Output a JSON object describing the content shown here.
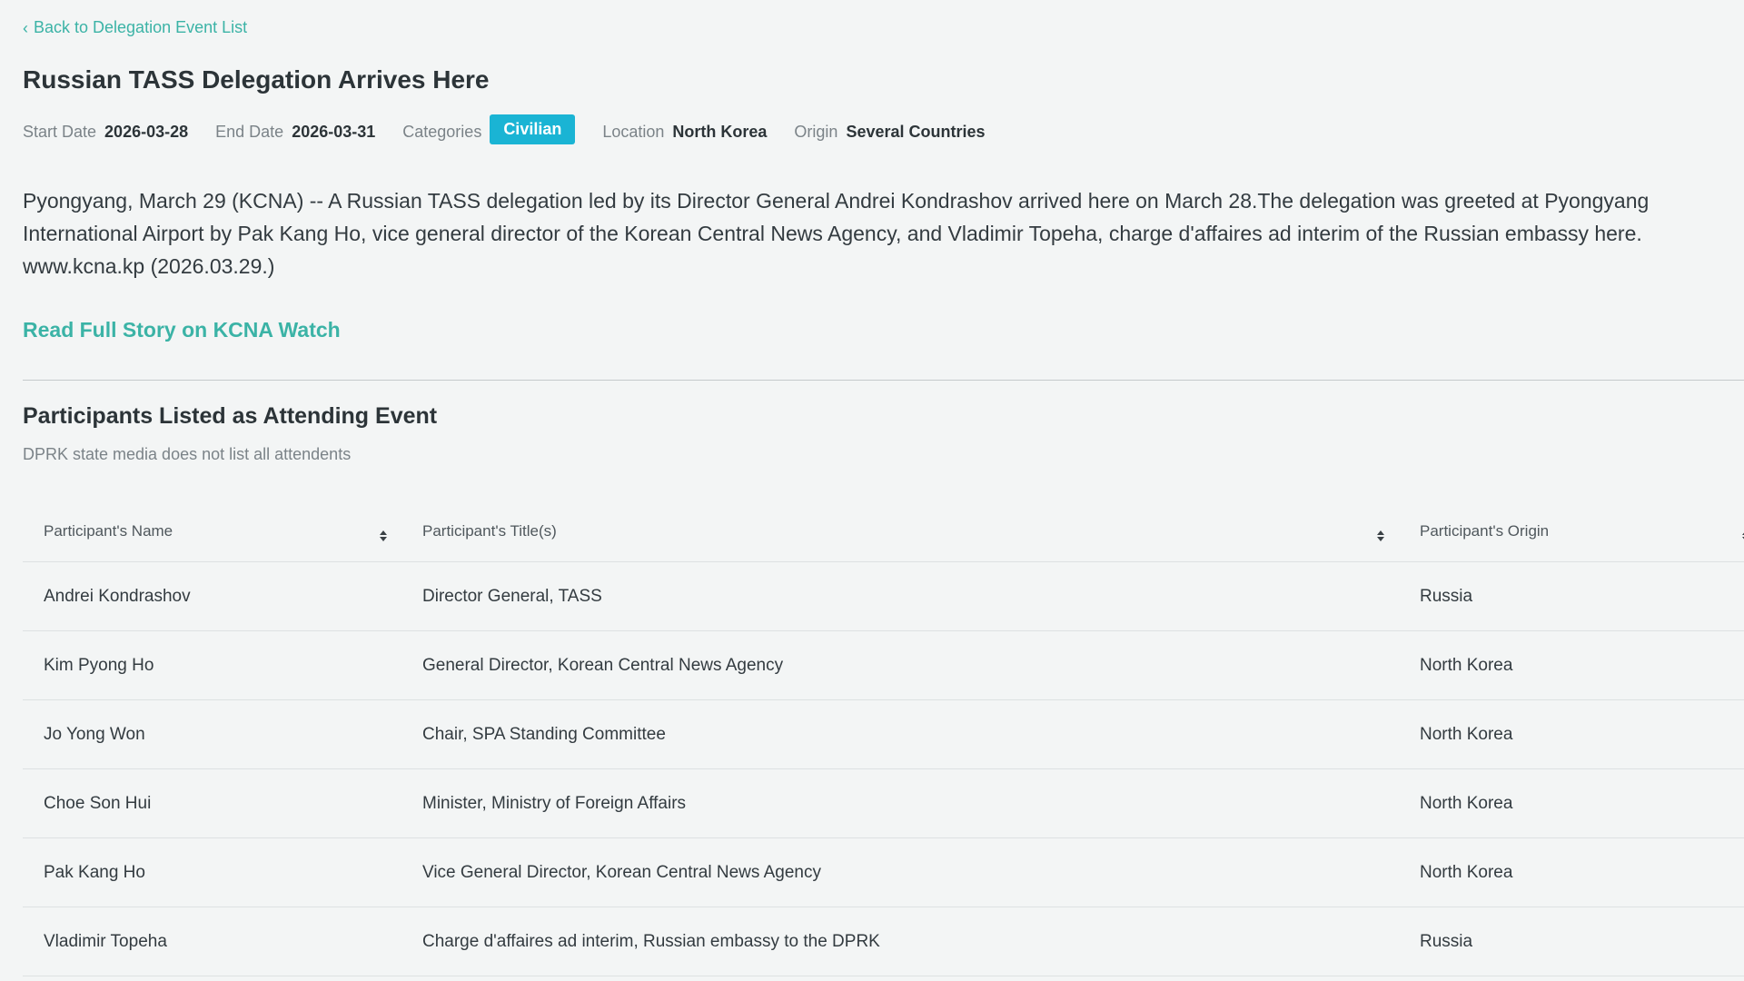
{
  "nav": {
    "back_label": "Back to Delegation Event List"
  },
  "event": {
    "title": "Russian TASS Delegation Arrives Here",
    "meta": {
      "start_date_label": "Start Date",
      "start_date": "2026-03-28",
      "end_date_label": "End Date",
      "end_date": "2026-03-31",
      "categories_label": "Categories",
      "category": "Civilian",
      "location_label": "Location",
      "location": "North Korea",
      "origin_label": "Origin",
      "origin": "Several Countries"
    },
    "description": "Pyongyang, March 29 (KCNA) -- A Russian TASS delegation led by its Director General Andrei Kondrashov arrived here on March 28.The delegation was greeted at Pyongyang International Airport by Pak Kang Ho, vice general director of the Korean Central News Agency, and Vladimir Topeha, charge d'affaires ad interim of the Russian embassy here. www.kcna.kp (2026.03.29.)",
    "read_full_label": "Read Full Story on KCNA Watch"
  },
  "participants": {
    "title": "Participants Listed as Attending Event",
    "subtitle": "DPRK state media does not list all attendents",
    "columns": [
      "Participant's Name",
      "Participant's Title(s)",
      "Participant's Origin"
    ],
    "rows": [
      {
        "name": "Andrei Kondrashov",
        "title": "Director General, TASS",
        "origin": "Russia"
      },
      {
        "name": "Kim Pyong Ho",
        "title": "General Director, Korean Central News Agency",
        "origin": "North Korea"
      },
      {
        "name": "Jo Yong Won",
        "title": "Chair, SPA Standing Committee",
        "origin": "North Korea"
      },
      {
        "name": "Choe Son Hui",
        "title": "Minister, Ministry of Foreign Affairs",
        "origin": "North Korea"
      },
      {
        "name": "Pak Kang Ho",
        "title": "Vice General Director, Korean Central News Agency",
        "origin": "North Korea"
      },
      {
        "name": "Vladimir Topeha",
        "title": "Charge d'affaires ad interim, Russian embassy to the DPRK",
        "origin": "Russia"
      }
    ]
  },
  "colors": {
    "accent": "#3bb3a6",
    "badge": "#1ab4d4",
    "background": "#f3f5f5"
  },
  "icons": {
    "back": "chevron-left-icon",
    "sort": "sort-icon"
  }
}
